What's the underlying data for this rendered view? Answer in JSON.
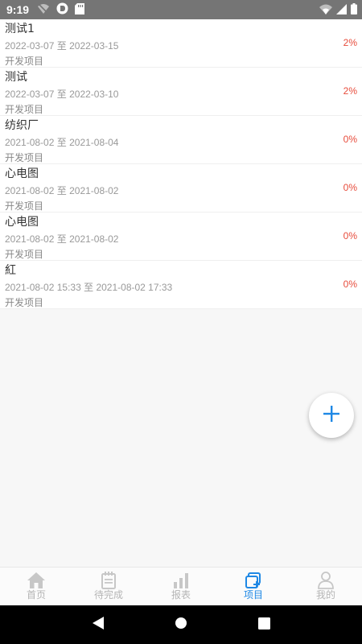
{
  "status_bar": {
    "time": "9:19",
    "icons_left": [
      "wifi-off-icon",
      "vpn-icon",
      "sd-card-icon"
    ],
    "icons_right": [
      "wifi-icon",
      "signal-icon",
      "battery-icon"
    ]
  },
  "projects": [
    {
      "name": "测试1",
      "start": "2022-03-07",
      "sep": "至",
      "end": "2022-03-15",
      "type": "开发项目",
      "progress": "2%"
    },
    {
      "name": "测试",
      "start": "2022-03-07",
      "sep": "至",
      "end": "2022-03-10",
      "type": "开发项目",
      "progress": "2%"
    },
    {
      "name": "纺织厂",
      "start": "2021-08-02",
      "sep": "至",
      "end": "2021-08-04",
      "type": "开发项目",
      "progress": "0%"
    },
    {
      "name": "心电图",
      "start": "2021-08-02",
      "sep": "至",
      "end": "2021-08-02",
      "type": "开发项目",
      "progress": "0%"
    },
    {
      "name": "心电图",
      "start": "2021-08-02",
      "sep": "至",
      "end": "2021-08-02",
      "type": "开发项目",
      "progress": "0%"
    },
    {
      "name": "紅",
      "start": "2021-08-02 15:33",
      "sep": "至",
      "end": "2021-08-02 17:33",
      "type": "开发项目",
      "progress": "0%"
    }
  ],
  "fab": {
    "icon": "plus-icon",
    "color": "#1e88e5"
  },
  "bottom_nav": [
    {
      "label": "首页",
      "icon": "home-icon",
      "active": false
    },
    {
      "label": "待完成",
      "icon": "notepad-icon",
      "active": false
    },
    {
      "label": "报表",
      "icon": "bar-chart-icon",
      "active": false
    },
    {
      "label": "项目",
      "icon": "project-icon",
      "active": true
    },
    {
      "label": "我的",
      "icon": "user-icon",
      "active": false
    }
  ],
  "colors": {
    "accent": "#1e88e5",
    "progress": "#e74c3c",
    "inactive": "#b5b5b5"
  }
}
